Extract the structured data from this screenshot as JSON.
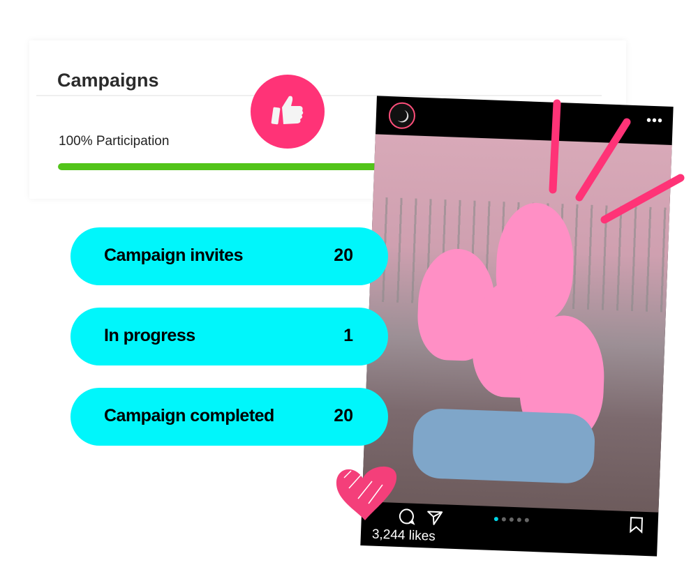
{
  "card": {
    "title": "Campaigns",
    "participation_label": "100% Participation",
    "participation_percent": 100,
    "colors": {
      "progress": "#52c41a"
    }
  },
  "badge": {
    "icon": "thumbs-up-icon",
    "color": "#ff3377"
  },
  "stats": [
    {
      "label": "Campaign invites",
      "value": "20"
    },
    {
      "label": "In progress",
      "value": "1"
    },
    {
      "label": "Campaign completed",
      "value": "20"
    }
  ],
  "stats_color": "#00f6fb",
  "post": {
    "avatar_icon": "moon-icon",
    "more_icon": "more-dots-icon",
    "likes": "3,244 likes",
    "carousel_total": 5,
    "carousel_active": 1,
    "actions": [
      "comment-icon",
      "share-icon",
      "bookmark-icon"
    ]
  },
  "decor": {
    "heart_color": "#f43f7a",
    "burst_color": "#ff3377"
  }
}
